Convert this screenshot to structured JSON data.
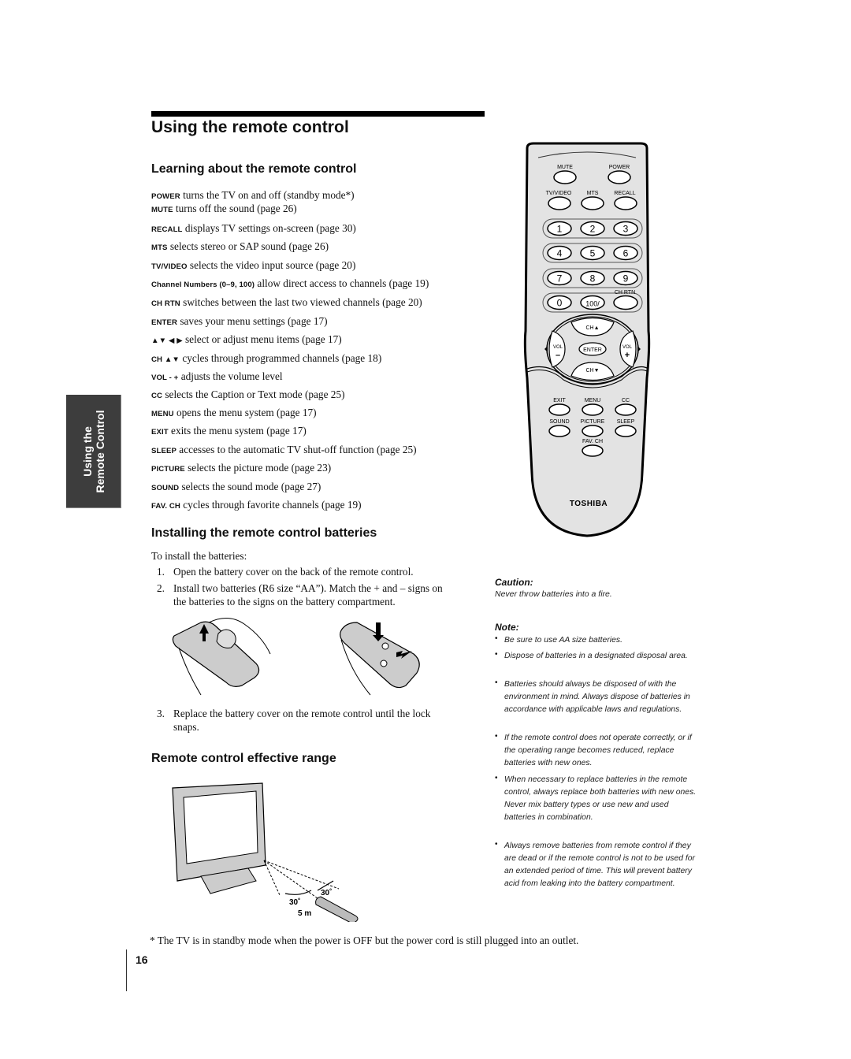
{
  "page_title": "Using the remote control",
  "side_tab": {
    "line1": "Using the",
    "line2": "Remote Control"
  },
  "learning": {
    "heading": "Learning about the remote control",
    "items": [
      {
        "key": "POWER",
        "text": " turns the TV on and off (standby mode*)"
      },
      {
        "key": "MUTE",
        "text": " turns off the sound (page 26)"
      },
      {
        "key": "RECALL",
        "text": " displays TV settings on-screen (page 30)"
      },
      {
        "key": "MTS",
        "text": " selects stereo or SAP sound (page 26)"
      },
      {
        "key": "TV/VIDEO",
        "text": " selects the video input source (page 20)"
      },
      {
        "key": "Channel Numbers (0–9, 100)",
        "text": " allow direct access to channels (page 19)"
      },
      {
        "key": "CH RTN",
        "text": " switches between the last two viewed channels (page 20)"
      },
      {
        "key": "ENTER",
        "text": " saves your menu settings (page 17)"
      },
      {
        "key": "▲▼ ◀ ▶",
        "text": " select or adjust menu items (page 17)"
      },
      {
        "key": "CH ▲▼",
        "text": " cycles through programmed channels (page 18)"
      },
      {
        "key": "VOL - +",
        "text": " adjusts the volume level"
      },
      {
        "key": "CC",
        "text": " selects the Caption or Text mode (page 25)"
      },
      {
        "key": "MENU",
        "text": " opens the menu system (page 17)"
      },
      {
        "key": "EXIT",
        "text": " exits the menu system (page 17)"
      },
      {
        "key": "SLEEP",
        "text": " accesses to the automatic TV shut-off function (page 25)"
      },
      {
        "key": "PICTURE",
        "text": " selects the picture mode (page 23)"
      },
      {
        "key": "SOUND",
        "text": " selects the sound mode (page 27)"
      },
      {
        "key": "FAV. CH",
        "text": " cycles through favorite channels (page 19)"
      }
    ]
  },
  "remote": {
    "labels": {
      "mute": "MUTE",
      "power": "POWER",
      "tv_video": "TV/VIDEO",
      "mts": "MTS",
      "recall": "RECALL",
      "ch_rtn": "CH RTN",
      "ch_up": "CH▲",
      "ch_down": "CH▼",
      "vol_left": "VOL",
      "vol_right": "VOL",
      "minus": "–",
      "plus": "+",
      "enter": "ENTER",
      "exit": "EXIT",
      "menu": "MENU",
      "cc": "CC",
      "sound": "SOUND",
      "picture": "PICTURE",
      "sleep": "SLEEP",
      "fav_ch": "FAV. CH",
      "brand": "TOSHIBA"
    },
    "digits": [
      "1",
      "2",
      "3",
      "4",
      "5",
      "6",
      "7",
      "8",
      "9",
      "0",
      "100/"
    ]
  },
  "installing": {
    "heading": "Installing the remote control batteries",
    "intro": "To install the batteries:",
    "steps": [
      {
        "num": "1.",
        "text": "Open the battery cover on the back of the remote control."
      },
      {
        "num": "2.",
        "text": "Install two batteries (R6 size “AA”). Match the + and – signs on",
        "text2": "the batteries to the signs on the battery compartment."
      },
      {
        "num": "3.",
        "text": "Replace the battery cover on the remote control until the lock",
        "text2": "snaps."
      }
    ]
  },
  "range": {
    "heading": "Remote control effective range",
    "angle_left": "30˚",
    "angle_right": "30˚",
    "distance": "5 m"
  },
  "caution": {
    "heading": "Caution:",
    "text": "Never throw batteries into a fire."
  },
  "note": {
    "heading": "Note:",
    "bullets": [
      "Be sure to use AA size batteries.",
      "Dispose of batteries in a designated disposal area.",
      "Batteries should always be disposed of with the environment in mind. Always dispose of batteries in accordance with applicable laws and regulations.",
      "If the remote control does not operate correctly, or if the operating range becomes reduced, replace batteries with new ones.",
      "When necessary to replace batteries in the remote control, always replace both batteries with new ones. Never mix battery types or use new and used batteries in combination.",
      "Always remove batteries from remote control if they are dead or if the remote control is not to be used for an extended period of time. This will prevent battery acid from leaking into the battery compartment."
    ]
  },
  "footnote": "* The TV is in standby mode when the power is OFF but the power cord is still plugged into an outlet.",
  "page_number": "16"
}
